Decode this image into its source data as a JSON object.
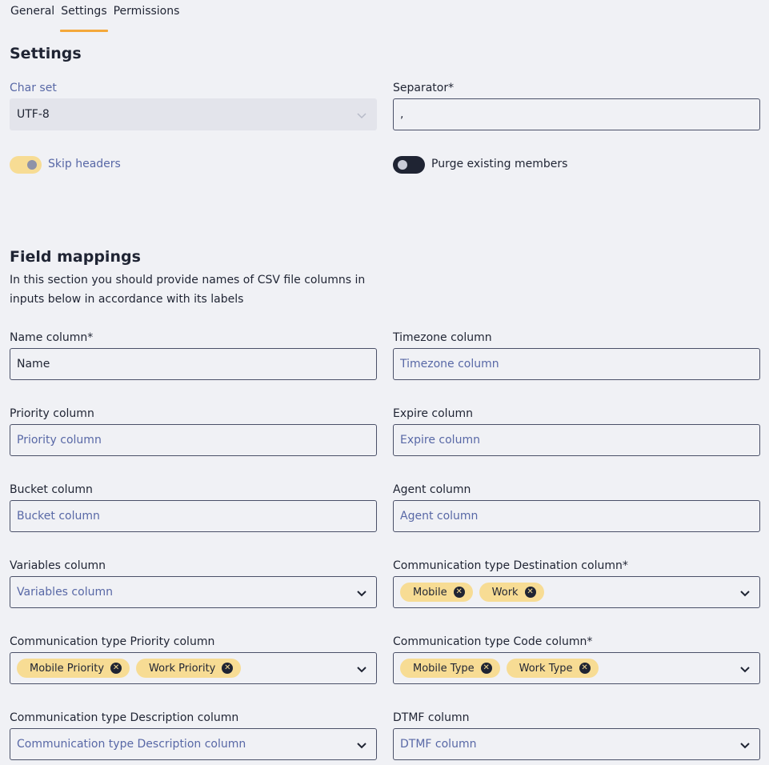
{
  "tabs": [
    {
      "label": "General"
    },
    {
      "label": "Settings"
    },
    {
      "label": "Permissions"
    }
  ],
  "settings": {
    "title": "Settings",
    "charset": {
      "label": "Char set",
      "value": "UTF-8"
    },
    "separator": {
      "label": "Separator*",
      "value": ","
    },
    "skip_headers": {
      "label": "Skip headers",
      "on": true
    },
    "purge_members": {
      "label": "Purge existing members",
      "on": false
    }
  },
  "mappings": {
    "title": "Field mappings",
    "description": "In this section you should provide names of CSV file columns in inputs below in accordance with its labels",
    "name": {
      "label": "Name column*",
      "value": "Name"
    },
    "timezone": {
      "label": "Timezone column",
      "placeholder": "Timezone column"
    },
    "priority": {
      "label": "Priority column",
      "placeholder": "Priority column"
    },
    "expire": {
      "label": "Expire column",
      "placeholder": "Expire column"
    },
    "bucket": {
      "label": "Bucket column",
      "placeholder": "Bucket column"
    },
    "agent": {
      "label": "Agent column",
      "placeholder": "Agent column"
    },
    "variables": {
      "label": "Variables column",
      "placeholder": "Variables column"
    },
    "comm_destination": {
      "label": "Communication type Destination column*",
      "chips": [
        "Mobile",
        "Work"
      ]
    },
    "comm_priority": {
      "label": "Communication type Priority column",
      "chips": [
        "Mobile Priority",
        "Work Priority"
      ]
    },
    "comm_code": {
      "label": "Communication type Code column*",
      "chips": [
        "Mobile Type",
        "Work Type"
      ]
    },
    "comm_description": {
      "label": "Communication type Description column",
      "placeholder": "Communication type Description column"
    },
    "dtmf": {
      "label": "DTMF column",
      "placeholder": "DTMF column"
    }
  },
  "colors": {
    "accent": "#f4a83a",
    "chip": "#f7dc94",
    "border": "#4a5068",
    "placeholder": "#5868a6",
    "background": "#f0f1f5"
  },
  "icons": {
    "dropdown": "chevron-down-icon",
    "chip_remove": "close-circle-icon"
  }
}
